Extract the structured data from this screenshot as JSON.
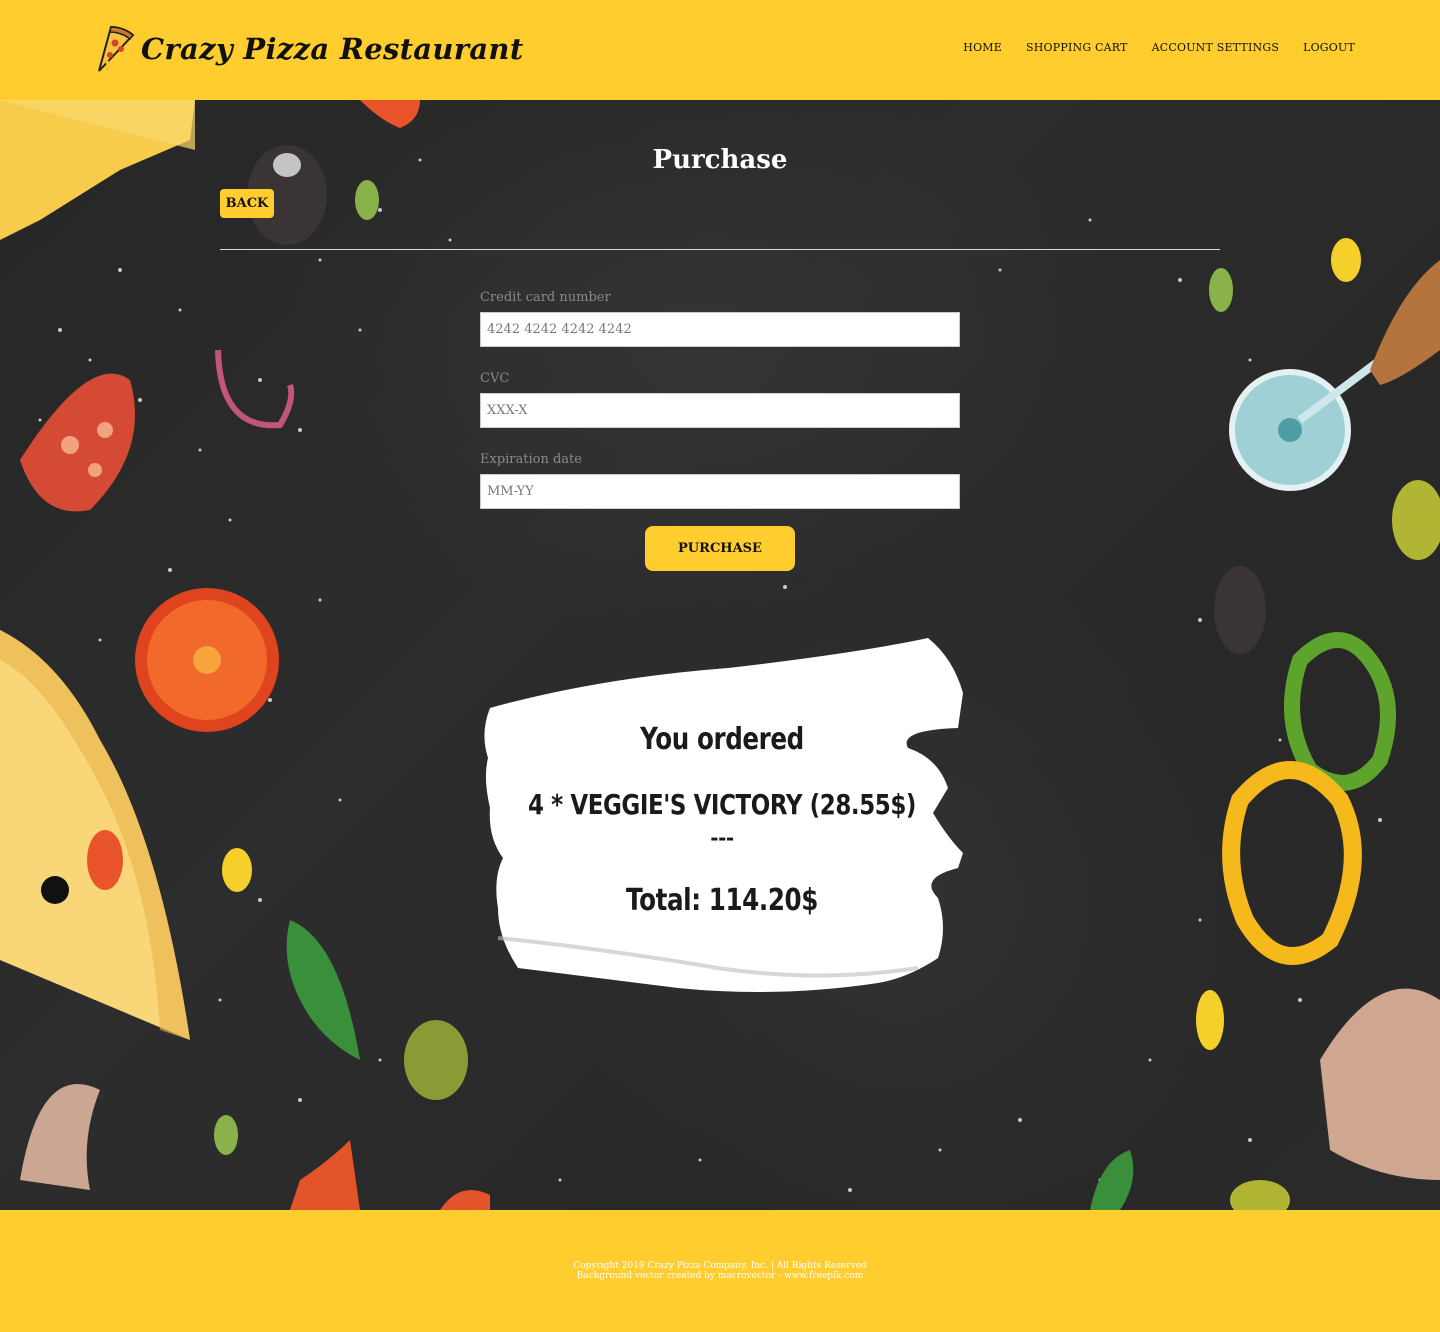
{
  "header": {
    "brand": "Crazy Pizza Restaurant",
    "logo_icon": "pizza-slice-icon",
    "nav": [
      "HOME",
      "SHOPPING CART",
      "ACCOUNT SETTINGS",
      "LOGOUT"
    ]
  },
  "page": {
    "title": "Purchase",
    "back_label": "BACK"
  },
  "form": {
    "card_label": "Credit card number",
    "card_placeholder": "4242 4242 4242 4242",
    "cvc_label": "CVC",
    "cvc_placeholder": "XXX-X",
    "exp_label": "Expiration date",
    "exp_placeholder": "MM-YY",
    "submit_label": "PURCHASE"
  },
  "order": {
    "heading": "You ordered",
    "items": [
      "4 * VEGGIE'S VICTORY (28.55$)"
    ],
    "separator": "---",
    "total": "Total: 114.20$"
  },
  "footer": {
    "copyright": "Copyright 2019 Crazy Pizza Company, Inc. | All Rights Reserved",
    "credit": "Background vector created by macrovector - www.freepik.com"
  },
  "colors": {
    "accent": "#ffcd2e",
    "background": "#2b2b2b",
    "text_dark": "#111111"
  }
}
